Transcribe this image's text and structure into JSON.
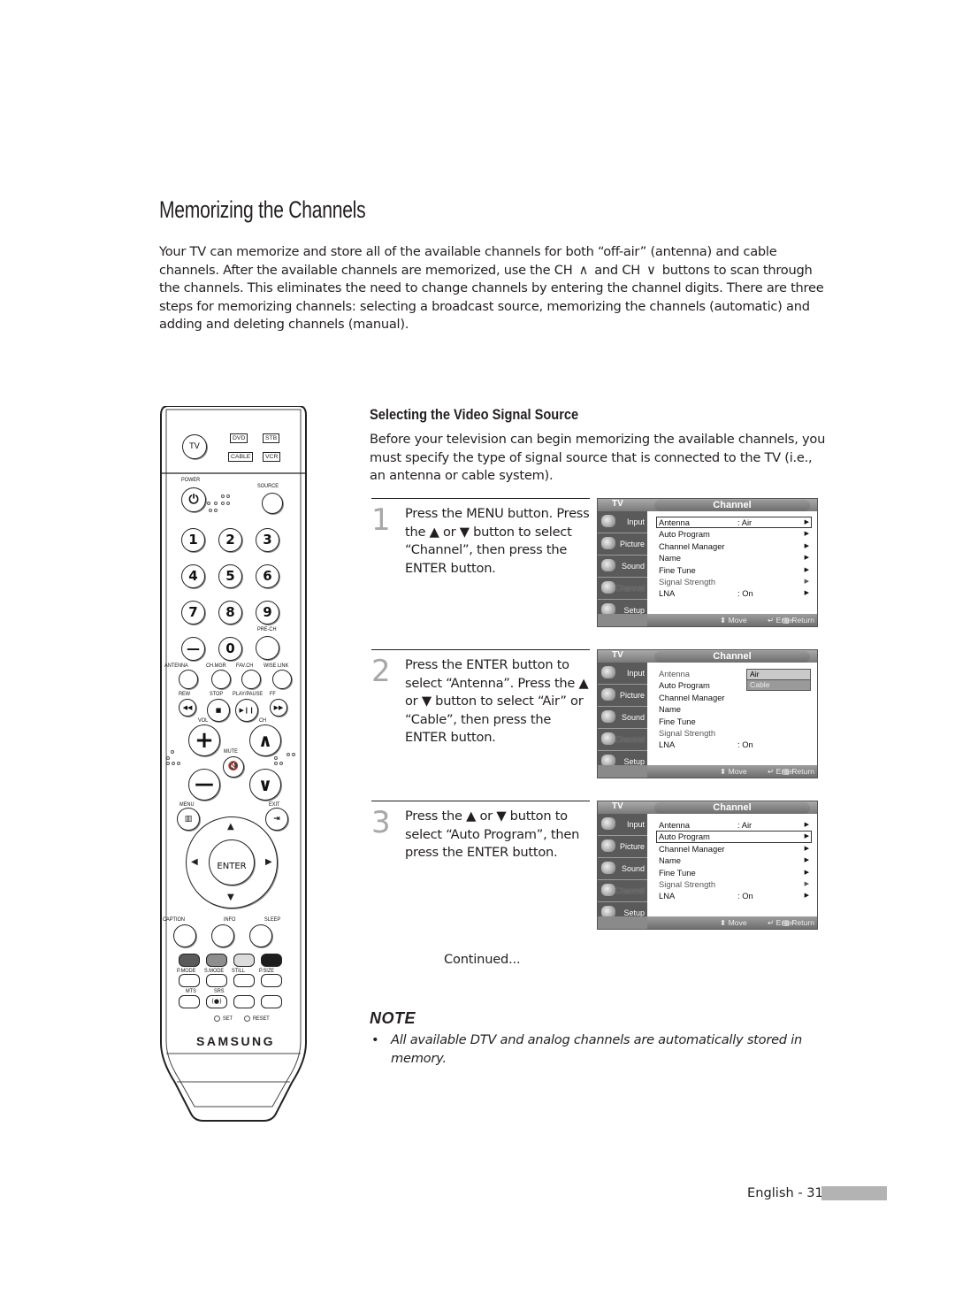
{
  "page": {
    "title": "Memorizing the Channels",
    "intro": {
      "part1": "Your TV can memorize and store all of the available channels for both “off-air” (antenna) and cable channels. After the available channels are memorized, use the CH",
      "ch_up_glyph": "∧",
      "part2": "and CH",
      "ch_down_glyph": "∨",
      "part3": "buttons to scan through the channels. This eliminates the need to change channels by entering the channel digits. There are three steps for memorizing channels: selecting a broadcast source, memorizing the channels (automatic) and adding and deleting channels (manual)."
    },
    "section": {
      "heading": "Selecting the Video Signal Source",
      "body": "Before your television can begin memorizing the available channels, you must specify the type of signal source that is connected to the TV (i.e., an antenna or cable system)."
    },
    "steps": [
      {
        "number": "1",
        "text": "Press the MENU button. Press the ▲ or ▼ button to select “Channel”, then press the ENTER button."
      },
      {
        "number": "2",
        "text": "Press the ENTER button to select “Antenna”. Press the ▲ or ▼ button to select “Air” or “Cable”, then press the ENTER button."
      },
      {
        "number": "3",
        "text": "Press the ▲ or ▼ button to select “Auto Program”, then press the ENTER button."
      }
    ],
    "continued": "Continued...",
    "note": {
      "heading": "NOTE",
      "bullet": "•",
      "text": "All available DTV and analog channels are automatically stored in memory."
    },
    "footer": {
      "label": "English - 31"
    }
  },
  "tv_menu": {
    "source_label": "TV",
    "title": "Channel",
    "sidebar": [
      {
        "label": "Input",
        "icon": "input-icon"
      },
      {
        "label": "Picture",
        "icon": "picture-icon"
      },
      {
        "label": "Sound",
        "icon": "sound-icon"
      },
      {
        "label": "Channel",
        "icon": "channel-icon"
      },
      {
        "label": "Setup",
        "icon": "setup-icon"
      }
    ],
    "items": [
      {
        "label": "Antenna",
        "value": ": Air"
      },
      {
        "label": "Auto Program",
        "value": ""
      },
      {
        "label": "Channel Manager",
        "value": ""
      },
      {
        "label": "Name",
        "value": ""
      },
      {
        "label": "Fine Tune",
        "value": ""
      },
      {
        "label": "Signal Strength",
        "value": ""
      },
      {
        "label": "LNA",
        "value": ": On"
      }
    ],
    "arrow": "▶",
    "footer": {
      "move": "⬍ Move",
      "enter": "↵ Enter",
      "return": "▥ Return"
    },
    "antenna_options": [
      "Air",
      "Cable"
    ],
    "screens": [
      {
        "selected_item": "Antenna",
        "popup_open": false
      },
      {
        "selected_item": "Antenna",
        "popup_open": true,
        "popup_selected": "Air"
      },
      {
        "selected_item": "Auto Program",
        "popup_open": false
      }
    ]
  },
  "remote": {
    "mode_buttons": [
      "TV",
      "DVD",
      "STB",
      "CABLE",
      "VCR"
    ],
    "power_label": "POWER",
    "source_label": "SOURCE",
    "digits": [
      "1",
      "2",
      "3",
      "4",
      "5",
      "6",
      "7",
      "8",
      "9",
      "—",
      "0"
    ],
    "prech_label": "PRE-CH",
    "func_labels": [
      "ANTENNA",
      "CH.MGR",
      "FAV.CH",
      "WISE LINK"
    ],
    "transport_labels": [
      "REW",
      "STOP",
      "PLAY/PAUSE",
      "FF"
    ],
    "transport_glyphs": [
      "◀◀",
      "■",
      "▶❙❙",
      "▶▶"
    ],
    "vol_label": "VOL",
    "ch_label": "CH",
    "mute_label": "MUTE",
    "menu_label": "MENU",
    "exit_label": "EXIT",
    "enter_label": "ENTER",
    "bottom_labels": [
      "CAPTION",
      "INFO",
      "SLEEP"
    ],
    "color_labels": [
      "P.MODE",
      "S.MODE",
      "STILL",
      "P.SIZE"
    ],
    "color_hex": [
      "#5a5a5a",
      "#8e8e8e",
      "#dcdcdc",
      "#1e1e1e"
    ],
    "misc_labels": [
      "MTS",
      "SRS"
    ],
    "set_label": "SET",
    "reset_label": "RESET",
    "brand": "SAMSUNG"
  }
}
